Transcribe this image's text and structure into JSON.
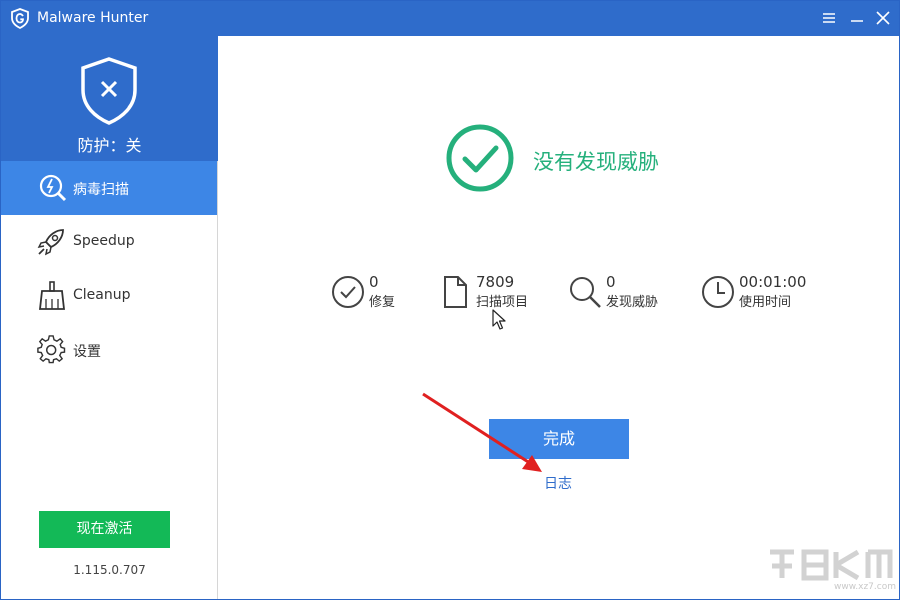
{
  "app": {
    "title": "Malware Hunter"
  },
  "colors": {
    "titlebar": "#2f6ccb",
    "active_nav": "#3d86e6",
    "success": "#25b07c",
    "activate": "#13b957",
    "arrow": "#e02020"
  },
  "sidebar": {
    "protection_status": "防护：关",
    "items": [
      {
        "label": "病毒扫描",
        "icon": "scan-icon",
        "active": true
      },
      {
        "label": "Speedup",
        "icon": "rocket-icon",
        "active": false
      },
      {
        "label": "Cleanup",
        "icon": "broom-icon",
        "active": false
      },
      {
        "label": "设置",
        "icon": "gear-icon",
        "active": false
      }
    ],
    "activate_label": "现在激活",
    "version": "1.115.0.707"
  },
  "main": {
    "result_text": "没有发现威胁",
    "stats": [
      {
        "value": "0",
        "caption": "修复",
        "icon": "check-circle-icon"
      },
      {
        "value": "7809",
        "caption": "扫描项目",
        "icon": "file-icon"
      },
      {
        "value": "0",
        "caption": "发现威胁",
        "icon": "search-icon"
      },
      {
        "value": "00:01:00",
        "caption": "使用时间",
        "icon": "clock-icon"
      }
    ],
    "done_label": "完成",
    "log_label": "日志"
  },
  "watermark": {
    "text": "www.xz7.com"
  }
}
